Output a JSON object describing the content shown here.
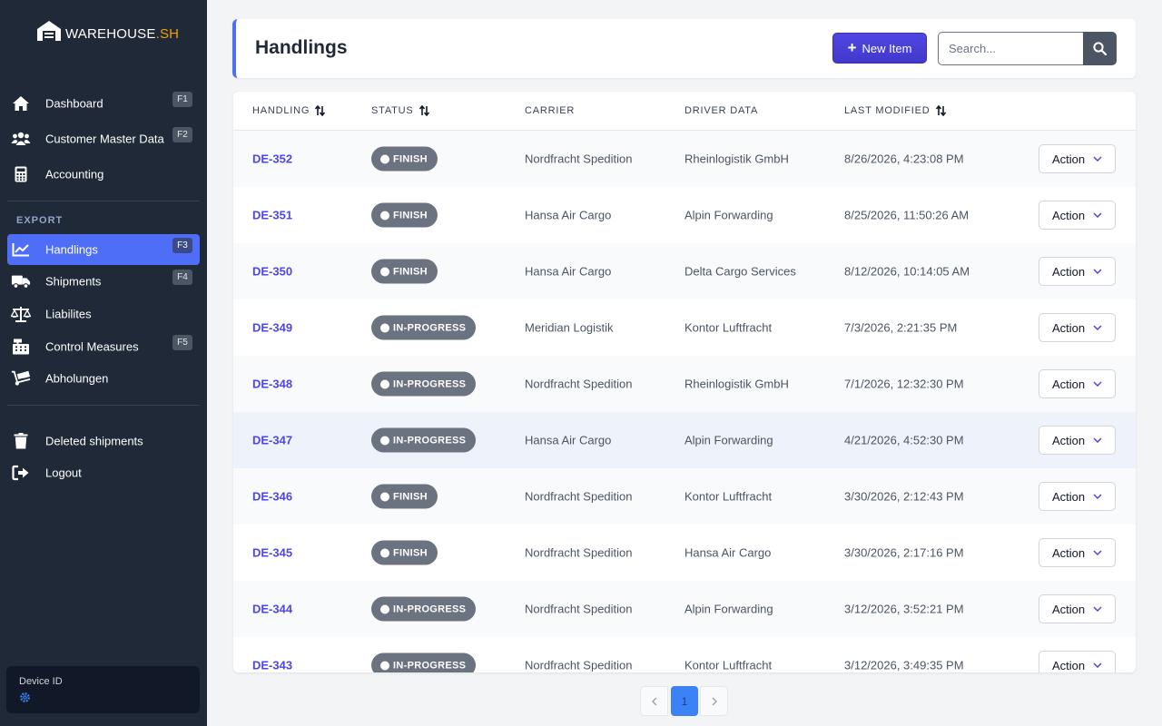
{
  "app": {
    "logo_text_main": "WAREHOUSE",
    "logo_text_accent": ".SH"
  },
  "sidebar": {
    "items": [
      {
        "label": "Dashboard",
        "icon": "home-icon",
        "shortcut": "F1"
      },
      {
        "label": "Customer Master Data",
        "icon": "users-icon",
        "shortcut": "F2"
      },
      {
        "label": "Accounting",
        "icon": "calculator-icon",
        "shortcut": ""
      }
    ],
    "section_label": "EXPORT",
    "export_items": [
      {
        "label": "Handlings",
        "icon": "chart-line-icon",
        "shortcut": "F3",
        "active": true
      },
      {
        "label": "Shipments",
        "icon": "truck-icon",
        "shortcut": "F4"
      },
      {
        "label": "Liabilites",
        "icon": "scale-icon",
        "shortcut": ""
      },
      {
        "label": "Control Measures",
        "icon": "cash-register-icon",
        "shortcut": "F5"
      },
      {
        "label": "Abholungen",
        "icon": "dolly-icon",
        "shortcut": ""
      }
    ],
    "footer_items": [
      {
        "label": "Deleted shipments",
        "icon": "trash-icon"
      },
      {
        "label": "Logout",
        "icon": "logout-icon"
      }
    ],
    "device": {
      "label": "Device ID",
      "icon": "gear-icon"
    }
  },
  "header": {
    "title": "Handlings",
    "new_button": "New Item",
    "search_placeholder": "Search..."
  },
  "table": {
    "columns": [
      "HANDLING",
      "STATUS",
      "CARRIER",
      "DRIVER DATA",
      "LAST MODIFIED"
    ],
    "action_label": "Action",
    "rows": [
      {
        "id": "DE-352",
        "status": "FINISH",
        "carrier": "Nordfracht Spedition",
        "driver": "Rheinlogistik GmbH",
        "modified": "8/26/2026, 4:23:08 PM"
      },
      {
        "id": "DE-351",
        "status": "FINISH",
        "carrier": "Hansa Air Cargo",
        "driver": "Alpin Forwarding",
        "modified": "8/25/2026, 11:50:26 AM"
      },
      {
        "id": "DE-350",
        "status": "FINISH",
        "carrier": "Hansa Air Cargo",
        "driver": "Delta Cargo Services",
        "modified": "8/12/2026, 10:14:05 AM"
      },
      {
        "id": "DE-349",
        "status": "IN-PROGRESS",
        "carrier": "Meridian Logistik",
        "driver": "Kontor Luftfracht",
        "modified": "7/3/2026, 2:21:35 PM"
      },
      {
        "id": "DE-348",
        "status": "IN-PROGRESS",
        "carrier": "Nordfracht Spedition",
        "driver": "Rheinlogistik GmbH",
        "modified": "7/1/2026, 12:32:30 PM"
      },
      {
        "id": "DE-347",
        "status": "IN-PROGRESS",
        "carrier": "Hansa Air Cargo",
        "driver": "Alpin Forwarding",
        "modified": "4/21/2026, 4:52:30 PM"
      },
      {
        "id": "DE-346",
        "status": "FINISH",
        "carrier": "Nordfracht Spedition",
        "driver": "Kontor Luftfracht",
        "modified": "3/30/2026, 2:12:43 PM"
      },
      {
        "id": "DE-345",
        "status": "FINISH",
        "carrier": "Nordfracht Spedition",
        "driver": "Hansa Air Cargo",
        "modified": "3/30/2026, 2:17:16 PM"
      },
      {
        "id": "DE-344",
        "status": "IN-PROGRESS",
        "carrier": "Nordfracht Spedition",
        "driver": "Alpin Forwarding",
        "modified": "3/12/2026, 3:52:21 PM"
      },
      {
        "id": "DE-343",
        "status": "IN-PROGRESS",
        "carrier": "Nordfracht Spedition",
        "driver": "Kontor Luftfracht",
        "modified": "3/12/2026, 3:49:35 PM"
      }
    ]
  },
  "pagination": {
    "current": "1"
  },
  "colors": {
    "accent": "#4f6ef7",
    "sidebar_bg": "#1f2937",
    "brand_accent": "#f59e0b",
    "badge_bg": "#6b7280",
    "link": "#4f46e5"
  }
}
